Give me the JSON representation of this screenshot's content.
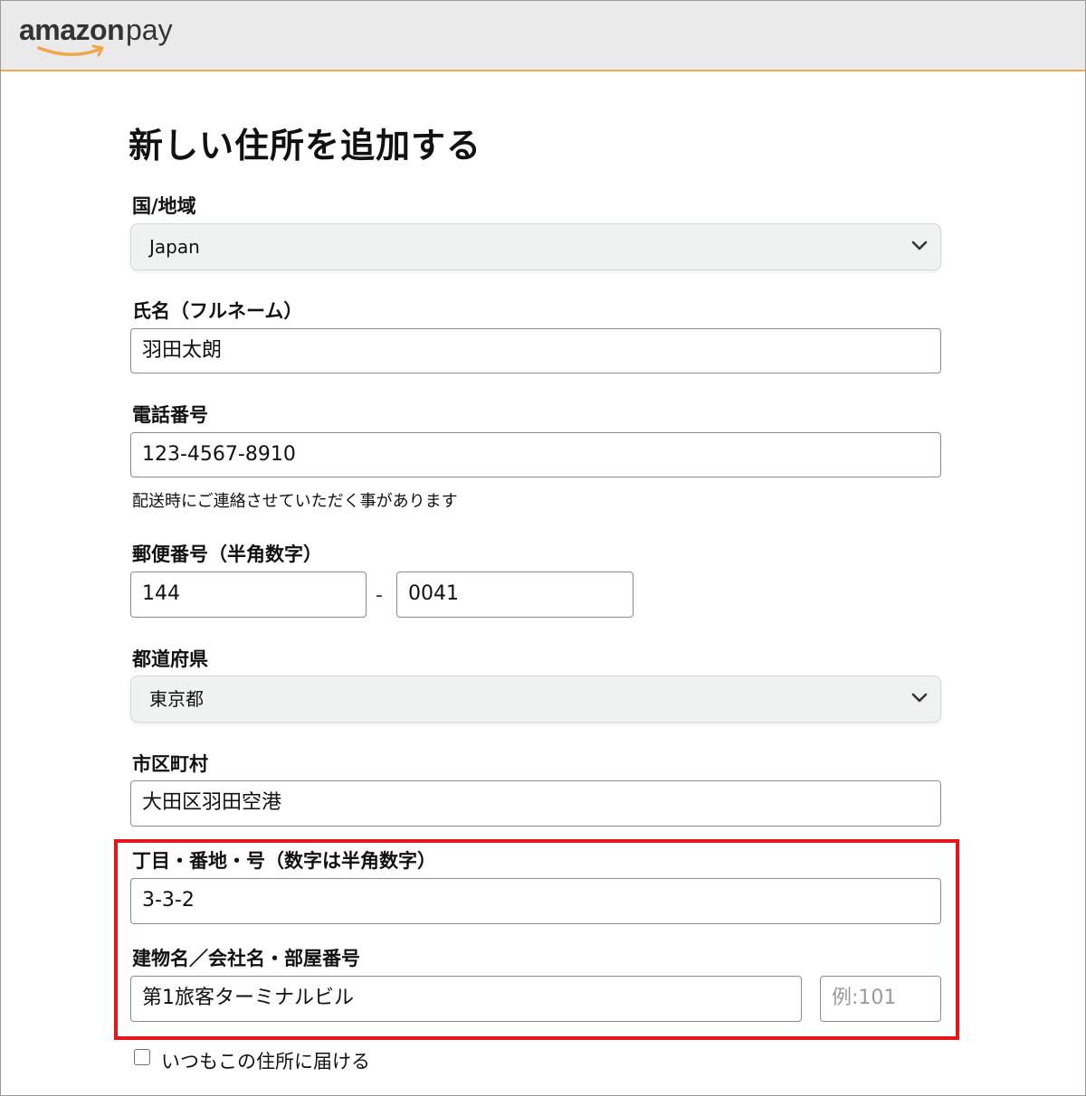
{
  "header": {
    "logo_brand": "amazon",
    "logo_suffix": "pay",
    "brand_accent": "#f0a64a"
  },
  "form": {
    "title": "新しい住所を追加する",
    "country": {
      "label": "国/地域",
      "value": "Japan",
      "icon": "chevron-down-icon"
    },
    "full_name": {
      "label": "氏名（フルネーム）",
      "value": "羽田太朗"
    },
    "phone": {
      "label": "電話番号",
      "value": "123-4567-8910",
      "hint": "配送時にご連絡させていただく事があります"
    },
    "postal_code": {
      "label": "郵便番号（半角数字）",
      "part1": "144",
      "separator": "-",
      "part2": "0041"
    },
    "prefecture": {
      "label": "都道府県",
      "value": "東京都",
      "icon": "chevron-down-icon"
    },
    "city": {
      "label": "市区町村",
      "value": "大田区羽田空港"
    },
    "address_line": {
      "label": "丁目・番地・号（数字は半角数字）",
      "value": "3-3-2"
    },
    "building": {
      "label": "建物名／会社名・部屋番号",
      "value": "第1旅客ターミナルビル",
      "room_placeholder": "例:101"
    },
    "default_checkbox": {
      "label": "いつもこの住所に届ける",
      "checked": false
    }
  },
  "highlight_color": "#e8141e"
}
